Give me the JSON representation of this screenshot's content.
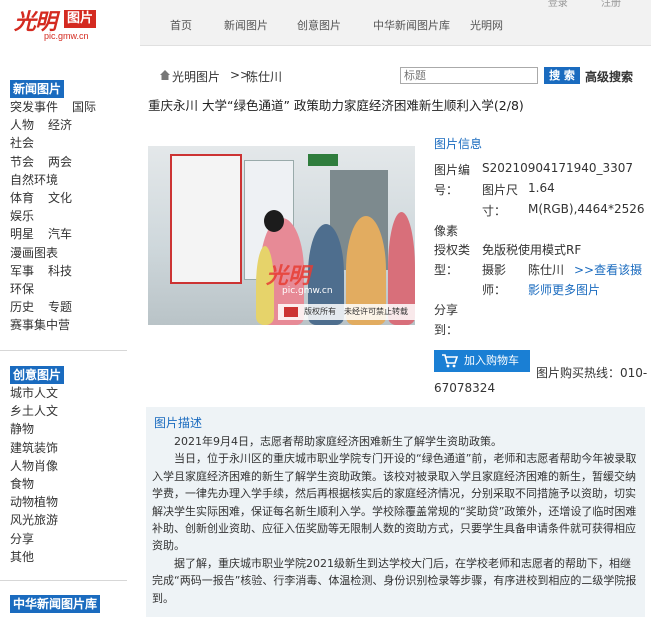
{
  "header": {
    "logo": {
      "brand": "光明",
      "tag": "图片",
      "url": "pic.gmw.cn"
    },
    "nav": [
      "首页",
      "新闻图片",
      "创意图片",
      "中华新闻图片库",
      "光明网"
    ],
    "top_links": [
      "登录",
      "注册"
    ]
  },
  "sidebar": {
    "news": {
      "title": "新闻图片",
      "rows": [
        [
          "突发事件",
          "国际"
        ],
        [
          "人物",
          "经济"
        ],
        [
          "社会"
        ],
        [
          "节会",
          "两会"
        ],
        [
          "自然环境"
        ],
        [
          "体育",
          "文化"
        ],
        [
          "娱乐"
        ],
        [
          "明星",
          "汽车"
        ],
        [
          "漫画图表"
        ],
        [
          "军事",
          "科技"
        ],
        [
          "环保"
        ],
        [
          "历史",
          "专题"
        ],
        [
          "赛事集中营"
        ]
      ]
    },
    "creative": {
      "title": "创意图片",
      "rows": [
        [
          "城市人文"
        ],
        [
          "乡土人文"
        ],
        [
          "静物"
        ],
        [
          "建筑装饰"
        ],
        [
          "人物肖像"
        ],
        [
          "食物"
        ],
        [
          "动物植物"
        ],
        [
          "风光旅游"
        ],
        [
          "分享"
        ],
        [
          "其他"
        ]
      ]
    },
    "library": {
      "title": "中华新闻图片库"
    }
  },
  "breadcrumb": {
    "section": "光明图片",
    "separator": ">>",
    "author": "陈仕川"
  },
  "search": {
    "placeholder": "标题",
    "button": "搜 索",
    "advanced": "高级搜索"
  },
  "title": "重庆永川 大学“绿色通道” 政策助力家庭经济困难新生顺利入学(2/8)",
  "photo": {
    "watermark_brand": "光明",
    "watermark_url": "pic.gmw.cn",
    "banner": "版权所有　未经许可禁止转载"
  },
  "info": {
    "heading": "图片信息",
    "id_label": "图片编",
    "id_value": "S20210904171940_3307",
    "id_label2": "号：",
    "size_label": "图片尺",
    "size_value": "1.64",
    "size_label2": "寸：",
    "size_value2": "M(RGB),4464*2526",
    "size_label3": "像素",
    "license_label": "授权类",
    "license_value": "免版税使用模式RF",
    "license_label2": "型：",
    "photographer_label": "摄影",
    "photographer_label2": "师：",
    "photographer_name": "陈仕川",
    "photographer_link": ">>查看该摄",
    "more_link": "影师更多图片",
    "share_label": "分享",
    "share_label2": "到："
  },
  "cart": {
    "label": "加入购物车",
    "hotline_label": "图片购买热线：010-",
    "hotline_number": "67078324"
  },
  "description": {
    "heading": "图片描述",
    "paragraphs": [
      "2021年9月4日，志愿者帮助家庭经济困难新生了解学生资助政策。",
      "当日，位于永川区的重庆城市职业学院专门开设的“绿色通道”前，老师和志愿者帮助今年被录取入学且家庭经济困难的新生了解学生资助政策。该校对被录取入学且家庭经济困难的新生，暂缓交纳学费，一律先办理入学手续，然后再根据核实后的家庭经济情况，分别采取不同措施予以资助，切实解决学生实际困难，保证每名新生顺利入学。学校除覆盖常规的“奖助贷”政策外，还增设了临时困难补助、创新创业资助、应征入伍奖励等无限制人数的资助方式，只要学生具备申请条件就可获得相应资助。",
      "据了解，重庆城市职业学院2021级新生到达学校大门后，在学校老师和志愿者的帮助下，相继完成“两码一报告”核验、行李消毒、体温检测、身份识别检录等步骤，有序进校到相应的二级学院报到。"
    ]
  },
  "colors": {
    "brand_red": "#d42a20",
    "accent_blue": "#1a6bbf",
    "desc_bg": "#eef3f6"
  }
}
